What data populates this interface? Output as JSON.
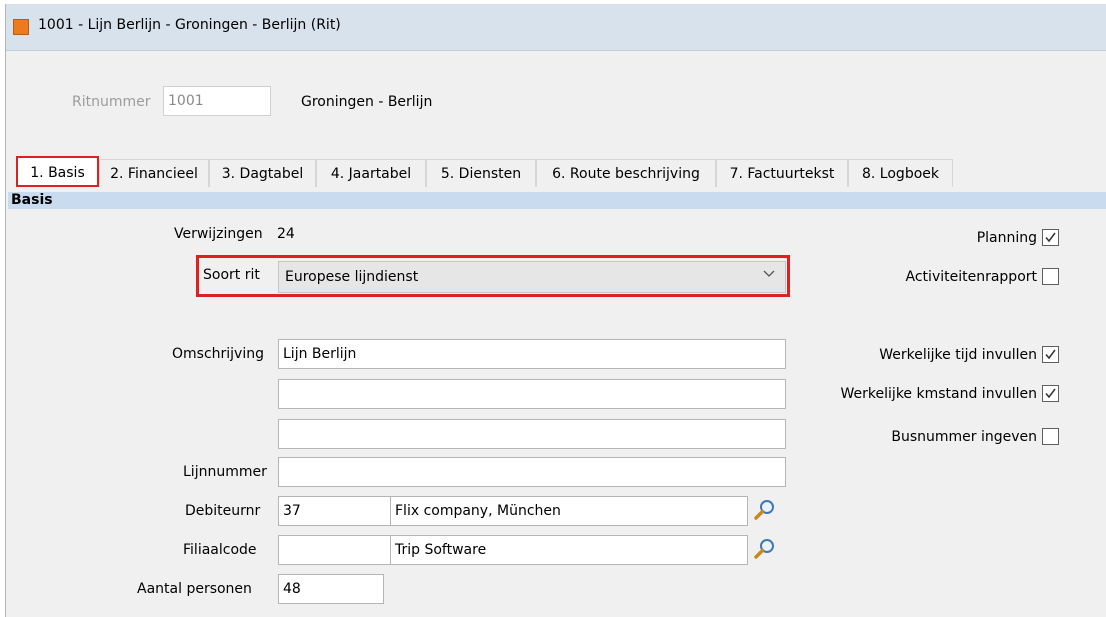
{
  "window": {
    "title": "1001 - Lijn Berlijn - Groningen - Berlijn (Rit)"
  },
  "header": {
    "ritnummer_label": "Ritnummer",
    "ritnummer_value": "1001",
    "route_text": "Groningen - Berlijn"
  },
  "tabs": [
    {
      "label": "1. Basis",
      "active": true
    },
    {
      "label": "2. Financieel",
      "active": false
    },
    {
      "label": "3. Dagtabel",
      "active": false
    },
    {
      "label": "4. Jaartabel",
      "active": false
    },
    {
      "label": "5. Diensten",
      "active": false
    },
    {
      "label": "6. Route beschrijving",
      "active": false
    },
    {
      "label": "7. Factuurtekst",
      "active": false
    },
    {
      "label": "8. Logboek",
      "active": false
    }
  ],
  "section": {
    "title": "Basis"
  },
  "form": {
    "verwijzingen_label": "Verwijzingen",
    "verwijzingen_value": "24",
    "soort_rit_label": "Soort rit",
    "soort_rit_value": "Europese lijndienst",
    "omschrijving_label": "Omschrijving",
    "omschrijving_1": "Lijn Berlijn",
    "omschrijving_2": "",
    "omschrijving_3": "",
    "lijnnummer_label": "Lijnnummer",
    "lijnnummer_value": "",
    "debiteurnr_label": "Debiteurnr",
    "debiteurnr_value": "37",
    "debiteur_name": "Flix company, München",
    "filiaalcode_label": "Filiaalcode",
    "filiaalcode_value": "",
    "filiaal_name": "Trip Software",
    "aantal_personen_label": "Aantal personen",
    "aantal_personen_value": "48"
  },
  "options": [
    {
      "label": "Planning",
      "checked": true
    },
    {
      "label": "Activiteitenrapport",
      "checked": false
    },
    {
      "label": "Werkelijke tijd invullen",
      "checked": true
    },
    {
      "label": "Werkelijke kmstand invullen",
      "checked": true
    },
    {
      "label": "Busnummer ingeven",
      "checked": false
    }
  ],
  "colors": {
    "highlight": "#e02020",
    "app_icon": "#ee7a1e",
    "section_header": "#c9dcef"
  }
}
